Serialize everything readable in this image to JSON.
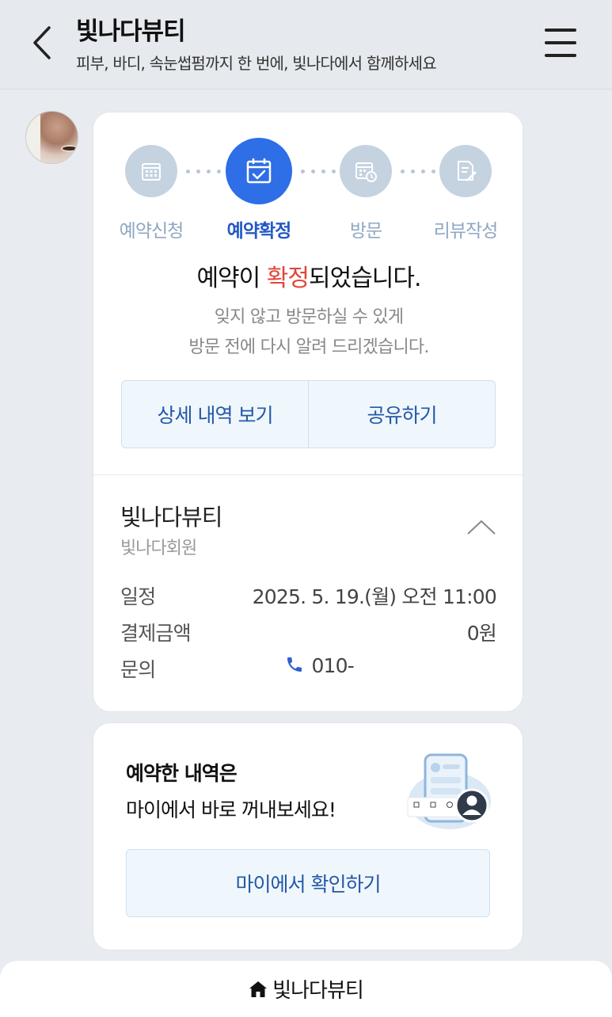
{
  "header": {
    "title": "빛나다뷰티",
    "subtitle": "피부, 바디, 속눈썹펌까지 한 번에, 빛나다에서 함께하세요"
  },
  "steps": [
    {
      "label": "예약신청",
      "icon": "calendar-icon",
      "active": false
    },
    {
      "label": "예약확정",
      "icon": "calendar-check-icon",
      "active": true
    },
    {
      "label": "방문",
      "icon": "calendar-clock-icon",
      "active": false
    },
    {
      "label": "리뷰작성",
      "icon": "edit-note-icon",
      "active": false
    }
  ],
  "confirmation": {
    "title_before": "예약이 ",
    "title_highlight": "확정",
    "title_after": "되었습니다.",
    "message_line1": "잊지 않고 방문하실 수 있게",
    "message_line2": "방문 전에 다시 알려 드리겠습니다.",
    "highlight_color": "#e0463a"
  },
  "actions": {
    "details_label": "상세 내역 보기",
    "share_label": "공유하기"
  },
  "booking": {
    "shop_name": "빛나다뷰티",
    "shop_sub": "빛나다회원",
    "rows": [
      {
        "label": "일정",
        "value": "2025. 5. 19.(월) 오전 11:00"
      },
      {
        "label": "결제금액",
        "value": "0원"
      },
      {
        "label": "문의",
        "value": "010-"
      }
    ]
  },
  "promo": {
    "line1": "예약한 내역은",
    "line2": "마이에서 바로 꺼내보세요!",
    "button_label": "마이에서 확인하기"
  },
  "bottom_bar": {
    "label": "빛나다뷰티",
    "icon": "home-icon"
  },
  "colors": {
    "accent": "#2e6ee6",
    "inactive_step": "#c5d2e0",
    "button_text": "#2458a8"
  }
}
